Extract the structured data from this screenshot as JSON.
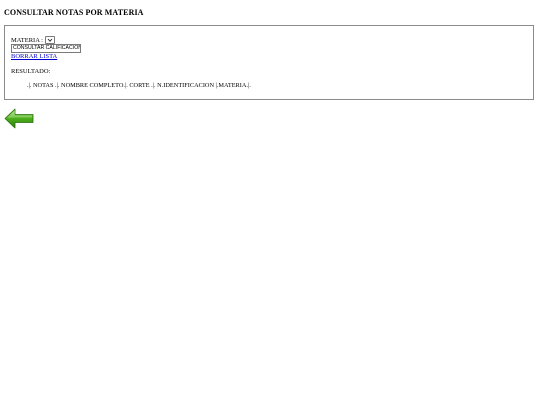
{
  "page": {
    "title": "CONSULTAR NOTAS POR MATERIA"
  },
  "form": {
    "materia_label": "MATERIA :",
    "materia_selected": "",
    "consultar_button": "CONSULTAR CALIFICACIONES",
    "borrar_link": "BORRAR LISTA",
    "resultado_label": "RESULTADO:",
    "result_header": ".|. NOTAS .|. NOMBRE COMPLETO.|. CORTE .|. N.IDENTIFICACION |.MATERIA.|."
  },
  "icons": {
    "back": "left-arrow-icon",
    "dropdown": "chevron-down-icon"
  },
  "colors": {
    "link": "#0000cc",
    "arrow_green": "#4caf1a",
    "panel_border": "#8a8a8a"
  }
}
